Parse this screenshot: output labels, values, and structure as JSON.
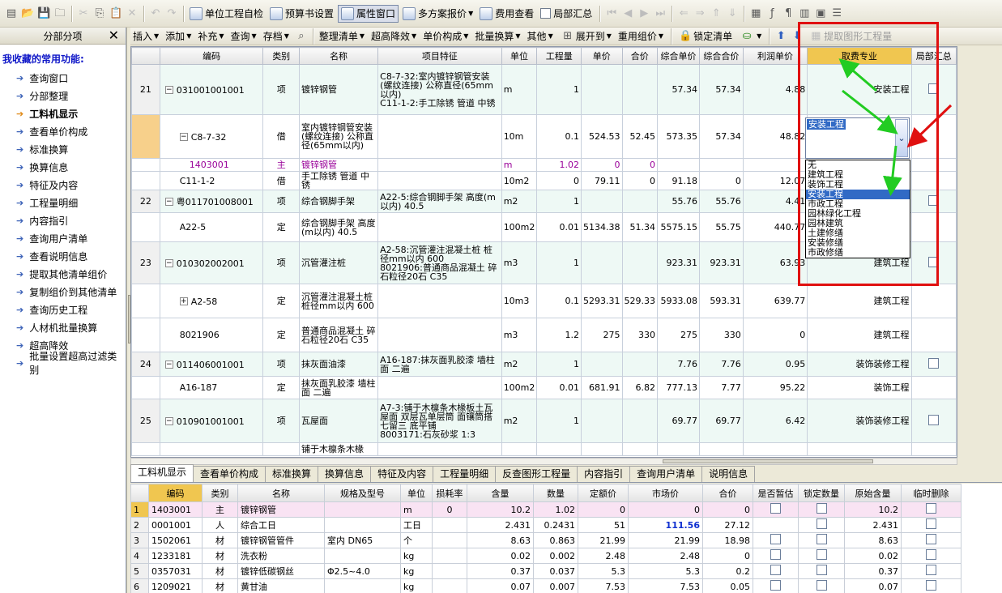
{
  "toolbar1": {
    "items": [
      {
        "label": "单位工程自检",
        "icon": "check-icon",
        "name": "unit-project-check-button"
      },
      {
        "label": "预算书设置",
        "icon": "gear-icon",
        "name": "budget-settings-button"
      },
      {
        "label": "属性窗口",
        "icon": "window-icon",
        "name": "property-window-button"
      },
      {
        "label": "多方案报价",
        "icon": "multi-plan-icon",
        "name": "multi-plan-quote-button"
      },
      {
        "label": "费用查看",
        "icon": "fee-icon",
        "name": "fee-view-button"
      }
    ],
    "partial_summary": "局部汇总"
  },
  "toolbar2": {
    "items": [
      "插入",
      "添加",
      "补充",
      "查询",
      "存档"
    ],
    "items2": [
      "整理清单",
      "超高降效",
      "单价构成",
      "批量换算",
      "其他"
    ],
    "expand": "展开到",
    "reuse": "重用组价",
    "lock": "锁定清单",
    "extract": "提取图形工程量"
  },
  "sidebar": {
    "title": "分部分项",
    "close": "✕",
    "fav_title": "我收藏的常用功能:",
    "items": [
      "查询窗口",
      "分部整理",
      "工料机显示",
      "查看单价构成",
      "标准换算",
      "换算信息",
      "特征及内容",
      "工程量明细",
      "内容指引",
      "查询用户清单",
      "查看说明信息",
      "提取其他清单组价",
      "复制组价到其他清单",
      "查询历史工程",
      "人材机批量换算",
      "超高降效",
      "批量设置超高过滤类别"
    ]
  },
  "grid": {
    "headers": [
      "编码",
      "类别",
      "名称",
      "项目特征",
      "单位",
      "工程量",
      "单价",
      "合价",
      "综合单价",
      "综合合价",
      "利润单价",
      "取费专业",
      "局部汇总"
    ],
    "rows": [
      {
        "rn": "21",
        "code": "031001001001",
        "tree": "−",
        "cls": "项",
        "name": "镀锌钢管",
        "feat": "C8-7-32:室内镀锌钢管安装(螺纹连接) 公称直径(65mm以内)\nC11-1-2:手工除锈 管道 中锈",
        "unit": "m",
        "qty": "1",
        "price": "",
        "total": "",
        "cu": "57.34",
        "ct": "57.34",
        "profit": "4.88",
        "spec": "安装工程",
        "cb": true
      },
      {
        "rn": "",
        "code": "C8-7-32",
        "tree": "−",
        "cls": "借",
        "name": "室内镀锌钢管安装(螺纹连接) 公称直径(65mm以内)",
        "feat": "",
        "unit": "10m",
        "qty": "0.1",
        "price": "524.53",
        "total": "52.45",
        "cu": "573.35",
        "ct": "57.34",
        "profit": "48.82",
        "spec": "安装工程",
        "cb": false
      },
      {
        "rn": "",
        "code": "1403001",
        "tree": "",
        "cls": "主",
        "name": "镀锌钢管",
        "feat": "",
        "unit": "m",
        "qty": "1.02",
        "price": "0",
        "total": "0",
        "cu": "",
        "ct": "",
        "profit": "",
        "spec": "",
        "cb": false
      },
      {
        "rn": "",
        "code": "C11-1-2",
        "tree": "",
        "cls": "借",
        "name": "手工除锈 管道 中锈",
        "feat": "",
        "unit": "10m2",
        "qty": "0",
        "price": "79.11",
        "total": "0",
        "cu": "91.18",
        "ct": "0",
        "profit": "12.07",
        "spec": "",
        "cb": false
      },
      {
        "rn": "22",
        "code": "粤011701008001",
        "tree": "−",
        "cls": "项",
        "name": "综合钢脚手架",
        "feat": "A22-5:综合钢脚手架 高度(m以内) 40.5",
        "unit": "m2",
        "qty": "1",
        "price": "",
        "total": "",
        "cu": "55.76",
        "ct": "55.76",
        "profit": "4.41",
        "spec": "",
        "cb": true
      },
      {
        "rn": "",
        "code": "A22-5",
        "tree": "",
        "cls": "定",
        "name": "综合钢脚手架 高度(m以内) 40.5",
        "feat": "",
        "unit": "100m2",
        "qty": "0.01",
        "price": "5134.38",
        "total": "51.34",
        "cu": "5575.15",
        "ct": "55.75",
        "profit": "440.77",
        "spec": "",
        "cb": false
      },
      {
        "rn": "23",
        "code": "010302002001",
        "tree": "−",
        "cls": "项",
        "name": "沉管灌注桩",
        "feat": "A2-58:沉管灌注混凝土桩 桩径mm以内 600\n8021906:普通商品混凝土 碎石粒径20石 C35",
        "unit": "m3",
        "qty": "1",
        "price": "",
        "total": "",
        "cu": "923.31",
        "ct": "923.31",
        "profit": "63.93",
        "spec": "建筑工程",
        "cb": true
      },
      {
        "rn": "",
        "code": "A2-58",
        "tree": "+",
        "cls": "定",
        "name": "沉管灌注混凝土桩 桩径mm以内 600",
        "feat": "",
        "unit": "10m3",
        "qty": "0.1",
        "price": "5293.31",
        "total": "529.33",
        "cu": "5933.08",
        "ct": "593.31",
        "profit": "639.77",
        "spec": "建筑工程",
        "cb": false
      },
      {
        "rn": "",
        "code": "8021906",
        "tree": "",
        "cls": "定",
        "name": "普通商品混凝土 碎石粒径20石 C35",
        "feat": "",
        "unit": "m3",
        "qty": "1.2",
        "price": "275",
        "total": "330",
        "cu": "275",
        "ct": "330",
        "profit": "0",
        "spec": "建筑工程",
        "cb": false
      },
      {
        "rn": "24",
        "code": "011406001001",
        "tree": "−",
        "cls": "项",
        "name": "抹灰面油漆",
        "feat": "A16-187:抹灰面乳胶漆 墙柱面 二遍",
        "unit": "m2",
        "qty": "1",
        "price": "",
        "total": "",
        "cu": "7.76",
        "ct": "7.76",
        "profit": "0.95",
        "spec": "装饰装修工程",
        "cb": true
      },
      {
        "rn": "",
        "code": "A16-187",
        "tree": "",
        "cls": "定",
        "name": "抹灰面乳胶漆 墙柱面 二遍",
        "feat": "",
        "unit": "100m2",
        "qty": "0.01",
        "price": "681.91",
        "total": "6.82",
        "cu": "777.13",
        "ct": "7.77",
        "profit": "95.22",
        "spec": "装饰工程",
        "cb": false
      },
      {
        "rn": "25",
        "code": "010901001001",
        "tree": "−",
        "cls": "项",
        "name": "瓦屋面",
        "feat": "A7-3:铺于木檩条木椽板土瓦屋面 双层瓦单层筒 面镶筒搭七留三 底平铺\n8003171:石灰砂浆 1:3",
        "unit": "m2",
        "qty": "1",
        "price": "",
        "total": "",
        "cu": "69.77",
        "ct": "69.77",
        "profit": "6.42",
        "spec": "装饰装修工程",
        "cb": true
      },
      {
        "rn": "",
        "code": "",
        "tree": "",
        "cls": "",
        "name": "铺于木檩条木椽",
        "feat": "",
        "unit": "",
        "qty": "",
        "price": "",
        "total": "",
        "cu": "",
        "ct": "",
        "profit": "",
        "spec": "",
        "cb": false
      }
    ]
  },
  "editor": {
    "value": "安装工程",
    "button": "⌄"
  },
  "dropdown": {
    "options": [
      "无",
      "建筑工程",
      "装饰工程",
      "安装工程",
      "市政工程",
      "园林绿化工程",
      "园林建筑",
      "土建修缮",
      "安装修缮",
      "市政修缮"
    ],
    "selected": "安装工程"
  },
  "tabs": {
    "items": [
      "工料机显示",
      "查看单价构成",
      "标准换算",
      "换算信息",
      "特征及内容",
      "工程量明细",
      "反查图形工程量",
      "内容指引",
      "查询用户清单",
      "说明信息"
    ],
    "active": "工料机显示"
  },
  "lower": {
    "headers": [
      "编码",
      "类别",
      "名称",
      "规格及型号",
      "单位",
      "损耗率",
      "含量",
      "数量",
      "定额价",
      "市场价",
      "合价",
      "是否暂估",
      "锁定数量",
      "原始含量",
      "临时删除"
    ],
    "rows": [
      {
        "rn": "1",
        "code": "1403001",
        "cls": "主",
        "name": "镀锌钢管",
        "spec": "",
        "unit": "m",
        "loss": "0",
        "cont": "10.2",
        "qty": "1.02",
        "dprice": "0",
        "mprice": "0",
        "total": "0",
        "orig": "10.2",
        "est": true
      },
      {
        "rn": "2",
        "code": "0001001",
        "cls": "人",
        "name": "综合工日",
        "spec": "",
        "unit": "工日",
        "loss": "",
        "cont": "2.431",
        "qty": "0.2431",
        "dprice": "51",
        "mprice": "111.56",
        "total": "27.12",
        "orig": "2.431",
        "est": false
      },
      {
        "rn": "3",
        "code": "1502061",
        "cls": "材",
        "name": "镀锌钢管管件",
        "spec": "室内 DN65",
        "unit": "个",
        "loss": "",
        "cont": "8.63",
        "qty": "0.863",
        "dprice": "21.99",
        "mprice": "21.99",
        "total": "18.98",
        "orig": "8.63",
        "est": true
      },
      {
        "rn": "4",
        "code": "1233181",
        "cls": "材",
        "name": "洗衣粉",
        "spec": "",
        "unit": "kg",
        "loss": "",
        "cont": "0.02",
        "qty": "0.002",
        "dprice": "2.48",
        "mprice": "2.48",
        "total": "0",
        "orig": "0.02",
        "est": true
      },
      {
        "rn": "5",
        "code": "0357031",
        "cls": "材",
        "name": "镀锌低碳钢丝",
        "spec": "Φ2.5~4.0",
        "unit": "kg",
        "loss": "",
        "cont": "0.37",
        "qty": "0.037",
        "dprice": "5.3",
        "mprice": "5.3",
        "total": "0.2",
        "orig": "0.37",
        "est": true
      },
      {
        "rn": "6",
        "code": "1209021",
        "cls": "材",
        "name": "黄甘油",
        "spec": "",
        "unit": "kg",
        "loss": "",
        "cont": "0.07",
        "qty": "0.007",
        "dprice": "7.53",
        "mprice": "7.53",
        "total": "0.05",
        "orig": "0.07",
        "est": true
      }
    ]
  },
  "colors": {
    "accent": "#316AC5",
    "annotation_box": "#E01010",
    "annotation_arrow_green": "#22CC22",
    "annotation_arrow_red": "#E01010",
    "header_highlight": "#F0C650"
  }
}
